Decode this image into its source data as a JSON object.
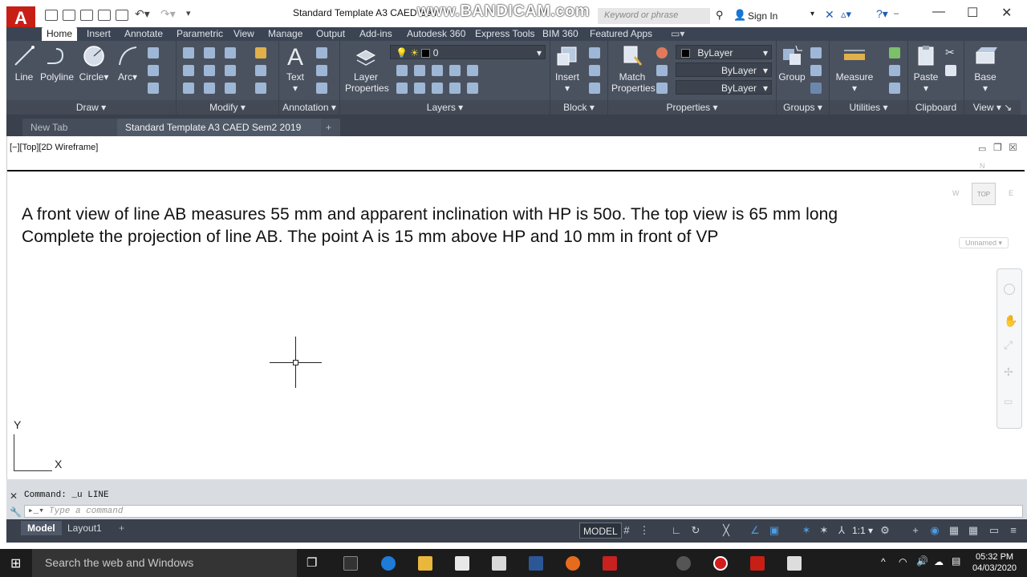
{
  "window": {
    "title": "Standard Template A3 CAED Sem",
    "watermark": "www.BANDICAM.com",
    "search_placeholder": "Keyword or phrase",
    "sign_in": "Sign In",
    "app_letter": "A"
  },
  "ribbon_tabs": [
    "Home",
    "Insert",
    "Annotate",
    "Parametric",
    "View",
    "Manage",
    "Output",
    "Add-ins",
    "Autodesk 360",
    "Express Tools",
    "BIM 360",
    "Featured Apps"
  ],
  "ribbon": {
    "draw": {
      "title": "Draw",
      "line": "Line",
      "polyline": "Polyline",
      "circle": "Circle",
      "arc": "Arc"
    },
    "modify": {
      "title": "Modify"
    },
    "annotation": {
      "title": "Annotation",
      "text": "Text"
    },
    "layers": {
      "title": "Layers",
      "layer_properties_1": "Layer",
      "layer_properties_2": "Properties",
      "current_layer": "0"
    },
    "block": {
      "title": "Block",
      "insert": "Insert"
    },
    "properties": {
      "title": "Properties",
      "match_1": "Match",
      "match_2": "Properties",
      "color": "ByLayer",
      "linetype": "ByLayer",
      "lineweight": "ByLayer"
    },
    "groups": {
      "title": "Groups",
      "group": "Group"
    },
    "utilities": {
      "title": "Utilities",
      "measure": "Measure"
    },
    "clipboard": {
      "title": "Clipboard",
      "paste": "Paste"
    },
    "view": {
      "title": "View",
      "base": "Base"
    }
  },
  "doc_tabs": {
    "new_tab": "New Tab",
    "active": "Standard Template A3 CAED Sem2 2019 20*"
  },
  "viewport": {
    "label": "[−][Top][2D Wireframe]",
    "line1": "A front view of line AB measures 55 mm and apparent inclination with HP is 50o. The top view is 65 mm long",
    "line2": "Complete the projection of line AB. The point A is 15 mm above HP and 10 mm in front of VP",
    "viewcube_top": "TOP",
    "viewcube_w": "W",
    "viewcube_e": "E",
    "viewcube_n": "N",
    "ucs_name": "Unnamed",
    "ucs_x": "X",
    "ucs_y": "Y"
  },
  "command": {
    "history": "Command: _u LINE",
    "placeholder": "Type a command"
  },
  "status": {
    "model_tab": "Model",
    "layout_tab": "Layout1",
    "model_button": "MODEL",
    "scale": "1:1"
  },
  "taskbar": {
    "search": "Search the web and Windows",
    "time": "05:32 PM",
    "date": "04/03/2020"
  }
}
